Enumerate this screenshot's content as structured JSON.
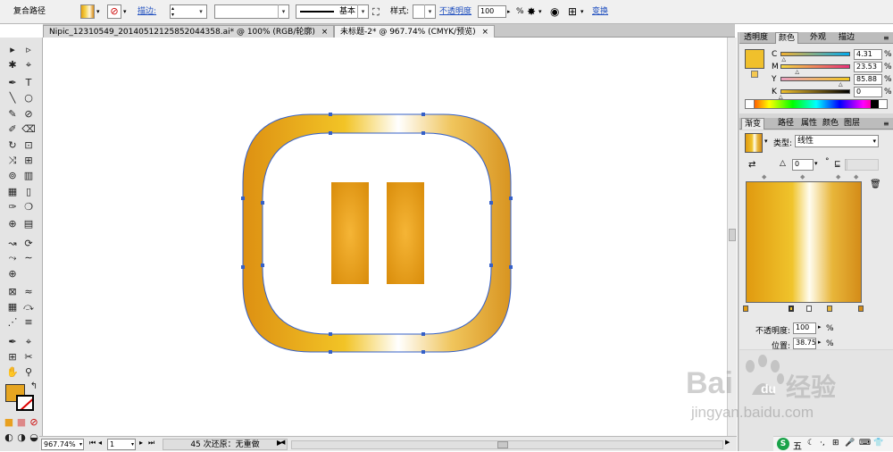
{
  "control_bar": {
    "selection_label": "复合路径",
    "stroke_label": "描边:",
    "stroke_weight_value": "",
    "brush_label": "基本",
    "style_label": "样式:",
    "opacity_label": "不透明度",
    "opacity_value": "100",
    "opacity_unit": "%",
    "transform_label": "变换"
  },
  "doc_tabs": [
    {
      "label": "Nipic_12310549_20140512125852044358.ai* @ 100% (RGB/轮廓)",
      "close": "×"
    },
    {
      "label": "未标题-2* @ 967.74% (CMYK/预览)",
      "close": "×"
    }
  ],
  "tools": {
    "rows": [
      [
        "▸",
        "▹"
      ],
      [
        "✱",
        "⌖"
      ],
      [
        "✒",
        "T"
      ],
      [
        "╲",
        "○"
      ],
      [
        "✎",
        "⊘"
      ],
      [
        "✐",
        "⌫"
      ],
      [
        "↻",
        "⊡"
      ],
      [
        "⤨",
        "⊞"
      ],
      [
        "⊚",
        "▥"
      ],
      [
        "▦",
        "▯"
      ],
      [
        "✑",
        "❍"
      ],
      [
        "⊕",
        "▤"
      ],
      [
        "↝",
        "⟳"
      ],
      [
        "⤳",
        "∼"
      ],
      [
        "⊕",
        ""
      ],
      [
        "⊠",
        "≈"
      ],
      [
        "▦",
        "⤼"
      ],
      [
        "⋰",
        "≡"
      ],
      [
        "✒",
        "⌖"
      ],
      [
        "⊞",
        "✂"
      ],
      [
        "✋",
        "⚲"
      ]
    ],
    "swap": "↰",
    "fill_color": "#e6a521",
    "mode_icons": [
      "■",
      "■",
      "⊘"
    ],
    "screen_icons": [
      "◐",
      "◑",
      "◒"
    ]
  },
  "status_bar": {
    "zoom": "967.74%",
    "page": "1",
    "undo_status": "45 次还原：无重做",
    "nav_prev": "◀",
    "nav_next": "▶"
  },
  "color_panel": {
    "tabs": [
      "透明度",
      "颜色",
      "外观",
      "描边"
    ],
    "active_tab": "颜色",
    "current_color": "#f0c02c",
    "channels": [
      {
        "label": "C",
        "value": "4.31",
        "fraction": 0.0431,
        "unit": "%",
        "gradient": "linear-gradient(90deg,#f2b030,#00aaee)"
      },
      {
        "label": "M",
        "value": "23.53",
        "fraction": 0.2353,
        "unit": "%",
        "gradient": "linear-gradient(90deg,#f4d840,#e8307a)"
      },
      {
        "label": "Y",
        "value": "85.88",
        "fraction": 0.8588,
        "unit": "%",
        "gradient": "linear-gradient(90deg,#eaa0c0,#f2c820)"
      },
      {
        "label": "K",
        "value": "0",
        "fraction": 0.0,
        "unit": "%",
        "gradient": "linear-gradient(90deg,#f0c02c,#000000)"
      }
    ]
  },
  "gradient_panel": {
    "tabs": [
      "渐变",
      "路径",
      "属性",
      "颜色",
      "图层"
    ],
    "active_tab": "渐变",
    "type_label": "类型:",
    "type_value": "线性",
    "angle_value": "0",
    "angle_unit": "°",
    "gradient_css": "linear-gradient(90deg,#e09a10 0%,#f0c42c 40%,#fffdf0 55%,#e8b63a 75%,#d48c18 100%)",
    "opacity_label": "不透明度:",
    "opacity_value": "100",
    "opacity_unit": "%",
    "location_label": "位置:",
    "location_value": "38.75",
    "location_unit": "%"
  },
  "artwork": {
    "frame_colors": [
      "#dd9012",
      "#f2c426",
      "#ffffff",
      "#f0c55c",
      "#d89420"
    ],
    "bar_colors": [
      "#d98c0a",
      "#f5b536"
    ],
    "path_color": "#3560c8"
  },
  "watermark": {
    "brand_prefix": "Bai",
    "brand_suffix": "经验",
    "url": "jingyan.baidu.com"
  },
  "taskbar": {
    "ime_label": "五",
    "icons": [
      "✦",
      "☾",
      "·,",
      "⊞",
      "🎤",
      "⌨",
      "👕"
    ]
  }
}
